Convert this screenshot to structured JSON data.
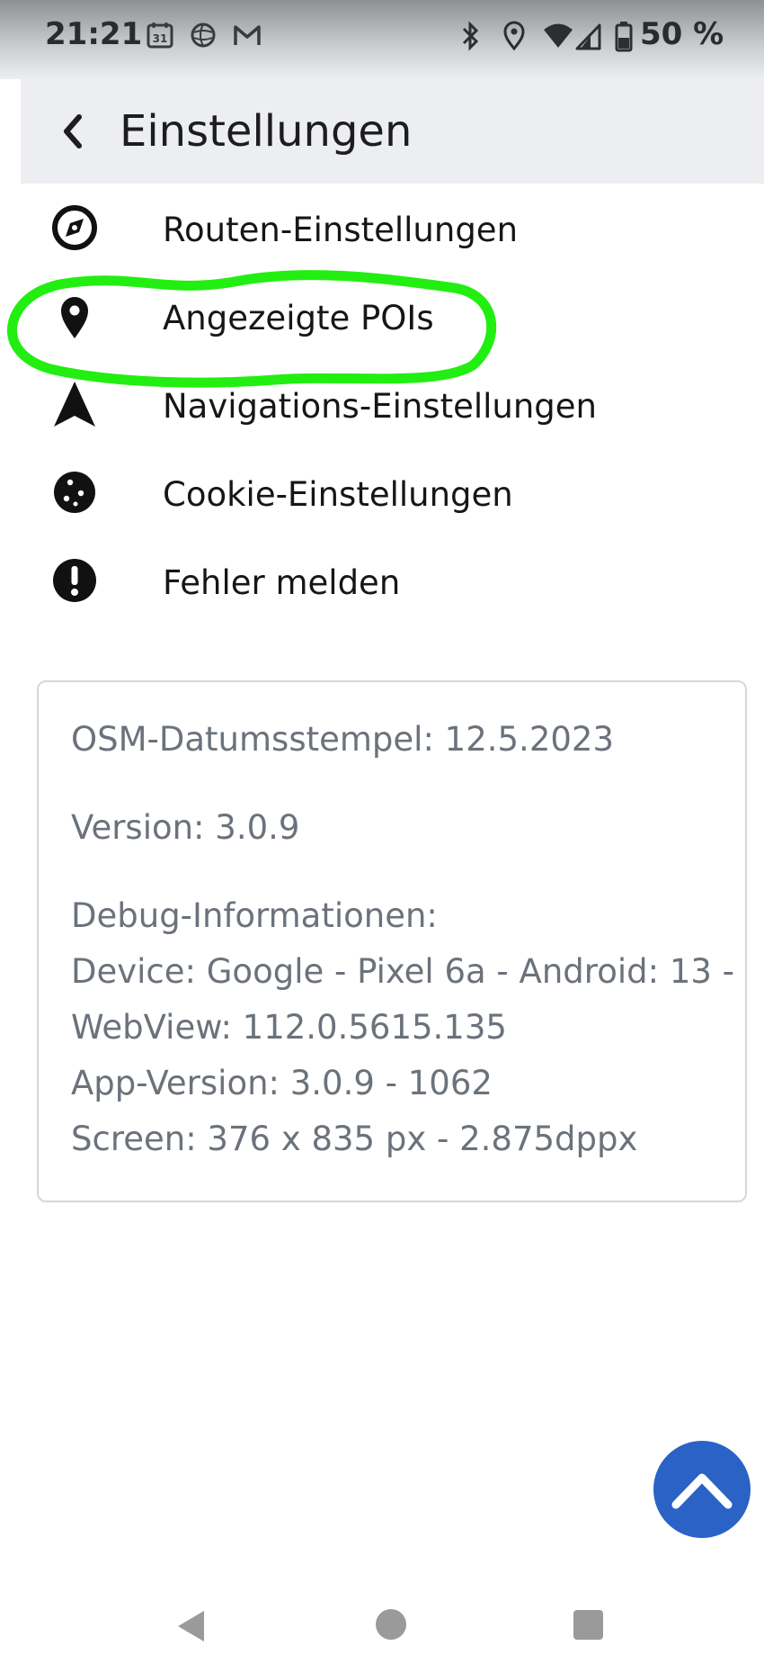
{
  "status_bar": {
    "time": "21:21",
    "battery_text": "50 %",
    "left_icons": [
      "calendar-icon",
      "web-icon",
      "gmail-icon"
    ],
    "right_icons": [
      "bluetooth-icon",
      "location-icon",
      "wifi-icon",
      "cell-signal-icon",
      "battery-icon"
    ],
    "calendar_day": "31"
  },
  "header": {
    "title": "Einstellungen",
    "back_icon": "chevron-left-icon",
    "background_color": "#eceef1"
  },
  "menu": {
    "items": [
      {
        "label": "Routen-Einstellungen",
        "icon": "compass-icon"
      },
      {
        "label": "Angezeigte POIs",
        "icon": "map-pin-icon",
        "highlighted": true
      },
      {
        "label": "Navigations-Einstellungen",
        "icon": "navigation-arrow-icon"
      },
      {
        "label": "Cookie-Einstellungen",
        "icon": "cookie-icon"
      },
      {
        "label": "Fehler melden",
        "icon": "exclamation-circle-icon"
      }
    ],
    "highlight_color": "#22ee11"
  },
  "info": {
    "osm_datestamp": "OSM-Datumsstempel: 12.5.2023",
    "version": "Version: 3.0.9",
    "debug_heading": "Debug-Informationen:",
    "debug_lines": [
      "Device: Google - Pixel 6a - Android: 13 -",
      "WebView: 112.0.5615.135",
      "App-Version: 3.0.9 - 1062",
      "Screen: 376 x 835 px - 2.875dppx"
    ]
  },
  "fab": {
    "icon": "chevron-up-icon",
    "color": "#2b62c5"
  },
  "nav_bar": {
    "buttons": [
      "nav-back-icon",
      "nav-home-icon",
      "nav-recents-icon"
    ]
  }
}
